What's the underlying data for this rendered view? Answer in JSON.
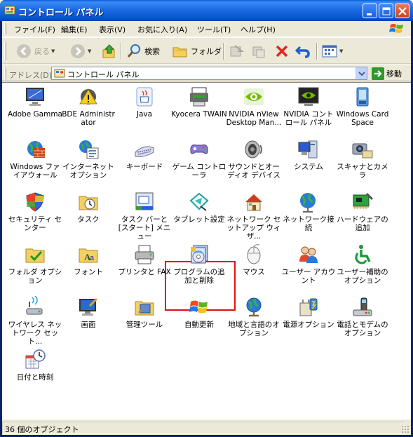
{
  "window": {
    "title": "コントロール パネル"
  },
  "menu": [
    "ファイル(F)",
    "編集(E)",
    "表示(V)",
    "お気に入り(A)",
    "ツール(T)",
    "ヘルプ(H)"
  ],
  "toolbar": {
    "back": "戻る",
    "search": "検索",
    "folders": "フォルダ"
  },
  "address": {
    "label": "アドレス(D)",
    "value": "コントロール パネル",
    "go": "移動"
  },
  "items": [
    {
      "label": "Adobe Gamma",
      "icon": "monitor-icon"
    },
    {
      "label": "BDE Administrator",
      "icon": "gear-warning-icon"
    },
    {
      "label": "Java",
      "icon": "java-cup-icon"
    },
    {
      "label": "Kyocera TWAIN",
      "icon": "printer-scanner-icon"
    },
    {
      "label": "NVIDIA nView Desktop Man...",
      "icon": "nvidia-eye-icon"
    },
    {
      "label": "NVIDIA コントロール パネル",
      "icon": "nvidia-panel-icon"
    },
    {
      "label": "Windows CardSpace",
      "icon": "cardspace-icon"
    },
    {
      "label": "Windows ファイアウォール",
      "icon": "firewall-icon"
    },
    {
      "label": "インターネット オプション",
      "icon": "internet-options-icon"
    },
    {
      "label": "キーボード",
      "icon": "keyboard-icon"
    },
    {
      "label": "ゲーム コントローラ",
      "icon": "gamepad-icon"
    },
    {
      "label": "サウンドとオーディオ デバイス",
      "icon": "speaker-icon"
    },
    {
      "label": "システム",
      "icon": "system-icon"
    },
    {
      "label": "スキャナとカメラ",
      "icon": "camera-icon"
    },
    {
      "label": "セキュリティ センター",
      "icon": "security-shield-icon"
    },
    {
      "label": "タスク",
      "icon": "task-folder-icon"
    },
    {
      "label": "タスク バーと [スタート] メニュー",
      "icon": "taskbar-icon"
    },
    {
      "label": "タブレット設定",
      "icon": "tablet-icon"
    },
    {
      "label": "ネットワーク セットアップ ウィザ...",
      "icon": "network-house-icon"
    },
    {
      "label": "ネットワーク接続",
      "icon": "network-globe-icon"
    },
    {
      "label": "ハードウェアの追加",
      "icon": "hardware-icon"
    },
    {
      "label": "フォルダ オプション",
      "icon": "folder-options-icon"
    },
    {
      "label": "フォント",
      "icon": "fonts-folder-icon"
    },
    {
      "label": "プリンタと FAX",
      "icon": "printer-icon"
    },
    {
      "label": "プログラムの追加と削除",
      "icon": "add-remove-programs-icon"
    },
    {
      "label": "マウス",
      "icon": "mouse-icon"
    },
    {
      "label": "ユーザー アカウント",
      "icon": "users-icon"
    },
    {
      "label": "ユーザー補助のオプション",
      "icon": "accessibility-icon"
    },
    {
      "label": "ワイヤレス ネットワーク セット...",
      "icon": "wireless-icon"
    },
    {
      "label": "画面",
      "icon": "display-icon"
    },
    {
      "label": "管理ツール",
      "icon": "admin-tools-icon"
    },
    {
      "label": "自動更新",
      "icon": "windows-update-icon"
    },
    {
      "label": "地域と言語のオプション",
      "icon": "globe-icon"
    },
    {
      "label": "電源オプション",
      "icon": "power-icon"
    },
    {
      "label": "電話とモデムのオプション",
      "icon": "phone-modem-icon"
    },
    {
      "label": "日付と時刻",
      "icon": "clock-calendar-icon"
    }
  ],
  "status": {
    "text": "36 個のオブジェクト"
  },
  "colors": {
    "highlight": "#e01010",
    "title_bar": "#0a52d0"
  }
}
